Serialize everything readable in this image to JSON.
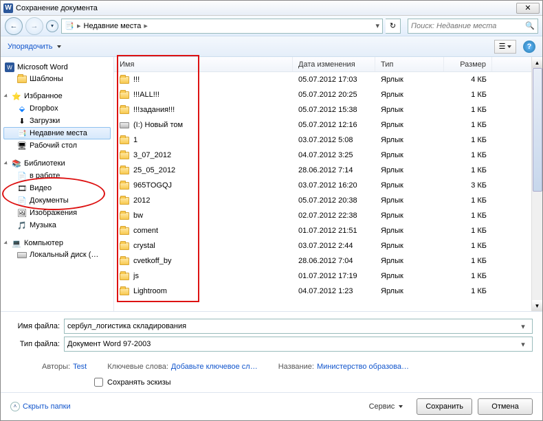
{
  "window": {
    "title": "Сохранение документа",
    "close_glyph": "✕"
  },
  "nav": {
    "path_root": "Недавние места",
    "search_placeholder": "Поиск: Недавние места"
  },
  "toolbar": {
    "organize": "Упорядочить"
  },
  "sidebar": {
    "word": {
      "label": "Microsoft Word",
      "templates": "Шаблоны"
    },
    "favorites": {
      "label": "Избранное",
      "items": [
        "Dropbox",
        "Загрузки",
        "Недавние места",
        "Рабочий стол"
      ]
    },
    "libraries": {
      "label": "Библиотеки",
      "items": [
        "в работе",
        "Видео",
        "Документы",
        "Изображения",
        "Музыка"
      ]
    },
    "computer": {
      "label": "Компьютер",
      "items": [
        "Локальный диск (…"
      ]
    }
  },
  "columns": {
    "name": "Имя",
    "date": "Дата изменения",
    "type": "Тип",
    "size": "Размер"
  },
  "files": [
    {
      "name": "!!!",
      "date": "05.07.2012 17:03",
      "type": "Ярлык",
      "size": "4 КБ",
      "icon": "folder"
    },
    {
      "name": "!!!ALL!!!",
      "date": "05.07.2012 20:25",
      "type": "Ярлык",
      "size": "1 КБ",
      "icon": "folder"
    },
    {
      "name": "!!!задания!!!",
      "date": "05.07.2012 15:38",
      "type": "Ярлык",
      "size": "1 КБ",
      "icon": "folder"
    },
    {
      "name": "(I:) Новый том",
      "date": "05.07.2012 12:16",
      "type": "Ярлык",
      "size": "1 КБ",
      "icon": "drive"
    },
    {
      "name": "1",
      "date": "03.07.2012 5:08",
      "type": "Ярлык",
      "size": "1 КБ",
      "icon": "folder"
    },
    {
      "name": "3_07_2012",
      "date": "04.07.2012 3:25",
      "type": "Ярлык",
      "size": "1 КБ",
      "icon": "folder"
    },
    {
      "name": "25_05_2012",
      "date": "28.06.2012 7:14",
      "type": "Ярлык",
      "size": "1 КБ",
      "icon": "folder"
    },
    {
      "name": "965TOGQJ",
      "date": "03.07.2012 16:20",
      "type": "Ярлык",
      "size": "3 КБ",
      "icon": "folder"
    },
    {
      "name": "2012",
      "date": "05.07.2012 20:38",
      "type": "Ярлык",
      "size": "1 КБ",
      "icon": "folder"
    },
    {
      "name": "bw",
      "date": "02.07.2012 22:38",
      "type": "Ярлык",
      "size": "1 КБ",
      "icon": "folder"
    },
    {
      "name": "coment",
      "date": "01.07.2012 21:51",
      "type": "Ярлык",
      "size": "1 КБ",
      "icon": "folder"
    },
    {
      "name": "crystal",
      "date": "03.07.2012 2:44",
      "type": "Ярлык",
      "size": "1 КБ",
      "icon": "folder"
    },
    {
      "name": "cvetkoff_by",
      "date": "28.06.2012 7:04",
      "type": "Ярлык",
      "size": "1 КБ",
      "icon": "folder"
    },
    {
      "name": "js",
      "date": "01.07.2012 17:19",
      "type": "Ярлык",
      "size": "1 КБ",
      "icon": "folder"
    },
    {
      "name": "Lightroom",
      "date": "04.07.2012 1:23",
      "type": "Ярлык",
      "size": "1 КБ",
      "icon": "folder"
    }
  ],
  "form": {
    "filename_label": "Имя файла:",
    "filename_value": "сербул_логистика складирования",
    "filetype_label": "Тип файла:",
    "filetype_value": "Документ Word 97-2003"
  },
  "meta": {
    "authors_label": "Авторы:",
    "authors_value": "Test",
    "keywords_label": "Ключевые слова:",
    "keywords_value": "Добавьте ключевое сл…",
    "title_label": "Название:",
    "title_value": "Министерство образова…",
    "thumbnails": "Сохранять эскизы"
  },
  "bottom": {
    "hide_folders": "Скрыть папки",
    "tools": "Сервис",
    "save": "Сохранить",
    "cancel": "Отмена"
  }
}
